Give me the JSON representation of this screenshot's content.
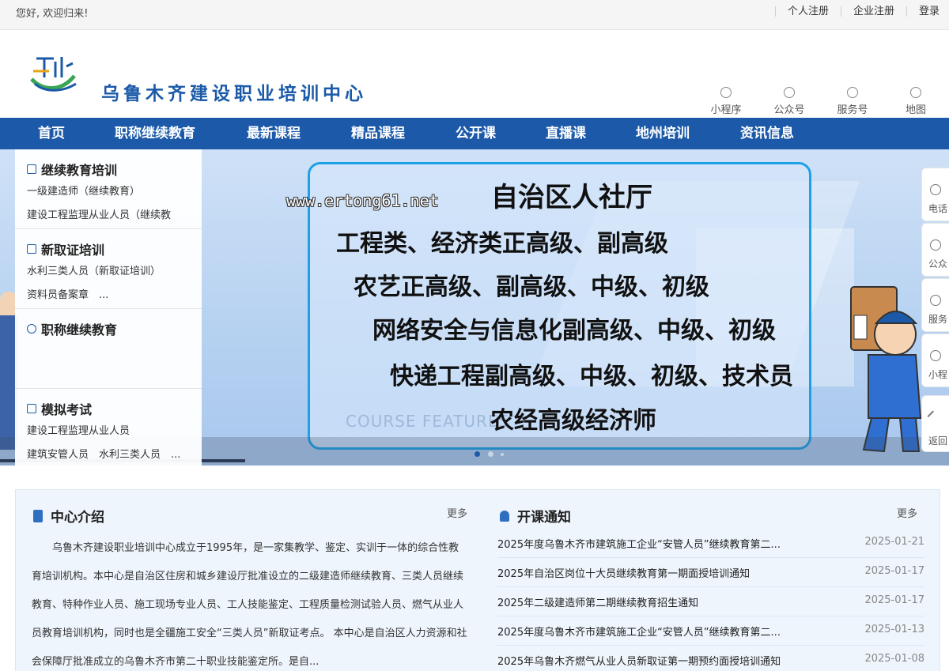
{
  "topbar": {
    "welcome": "您好, 欢迎归来!",
    "links": [
      "个人注册",
      "企业注册",
      "登录"
    ]
  },
  "header": {
    "title": "乌鲁木齐建设职业培训中心",
    "quick_links": [
      {
        "label": "小程序",
        "icon": "mini-program-icon"
      },
      {
        "label": "公众号",
        "icon": "wechat-icon"
      },
      {
        "label": "服务号",
        "icon": "wechat-service-icon"
      },
      {
        "label": "地图",
        "icon": "map-pin-icon"
      }
    ]
  },
  "nav": [
    "首页",
    "职称继续教育",
    "最新课程",
    "精品课程",
    "公开课",
    "直播课",
    "地州培训",
    "资讯信息"
  ],
  "side_menu": [
    {
      "title": "继续教育培训",
      "icon": "building-icon",
      "links": [
        "一级建造师（继续教育）",
        "建设工程监理从业人员（继续教"
      ]
    },
    {
      "title": "新取证培训",
      "icon": "document-icon",
      "links": [
        "水利三类人员（新取证培训）",
        "资料员备案章　..."
      ]
    },
    {
      "title": "职称继续教育",
      "icon": "user-icon",
      "links": []
    },
    {
      "title": "模拟考试",
      "icon": "clipboard-icon",
      "links": [
        "建设工程监理从业人员",
        "建筑安管人员　水利三类人员　..."
      ]
    }
  ],
  "banner": {
    "lines": [
      "自治区人社厅",
      "工程类、经济类正高级、副高级",
      "农艺正高级、副高级、中级、初级",
      "网络安全与信息化副高级、中级、初级",
      "快递工程副高级、中级、初级、技术员",
      "农经高级经济师"
    ],
    "watermark_en": "COURSE FEATURES",
    "watermark_url": "www.ertong61.net",
    "slides": 3,
    "active_slide": 1
  },
  "float_bar": [
    {
      "label": "电话",
      "icon": "phone-icon"
    },
    {
      "label": "公众",
      "icon": "wechat-icon"
    },
    {
      "label": "服务",
      "icon": "wechat-service-icon"
    },
    {
      "label": "小程",
      "icon": "mini-program-icon"
    },
    {
      "label": "返回",
      "icon": "back-top-icon"
    }
  ],
  "intro": {
    "title": "中心介绍",
    "more": "更多",
    "text": "乌鲁木齐建设职业培训中心成立于1995年，是一家集教学、鉴定、实训于一体的综合性教育培训机构。本中心是自治区住房和城乡建设厅批准设立的二级建造师继续教育、三类人员继续教育、特种作业人员、施工现场专业人员、工人技能鉴定、工程质量检测试验人员、燃气从业人员教育培训机构，同时也是全疆施工安全“三类人员”新取证考点。 本中心是自治区人力资源和社会保障厅批准成立的乌鲁木齐市第二十职业技能鉴定所。是自..."
  },
  "notices": {
    "title": "开课通知",
    "more": "更多",
    "items": [
      {
        "title": "2025年度乌鲁木齐市建筑施工企业“安管人员”继续教育第二...",
        "date": "2025-01-21"
      },
      {
        "title": "2025年自治区岗位十大员继续教育第一期面授培训通知",
        "date": "2025-01-17"
      },
      {
        "title": "2025年二级建造师第二期继续教育招生通知",
        "date": "2025-01-17"
      },
      {
        "title": "2025年度乌鲁木齐市建筑施工企业“安管人员”继续教育第二...",
        "date": "2025-01-13"
      },
      {
        "title": "2025年乌鲁木齐燃气从业人员新取证第一期预约面授培训通知",
        "date": "2025-01-08"
      }
    ]
  },
  "colors": {
    "brand_blue": "#1c5aa9",
    "title_blue": "#1b5aa8",
    "banner_border": "#1ea0e6"
  }
}
